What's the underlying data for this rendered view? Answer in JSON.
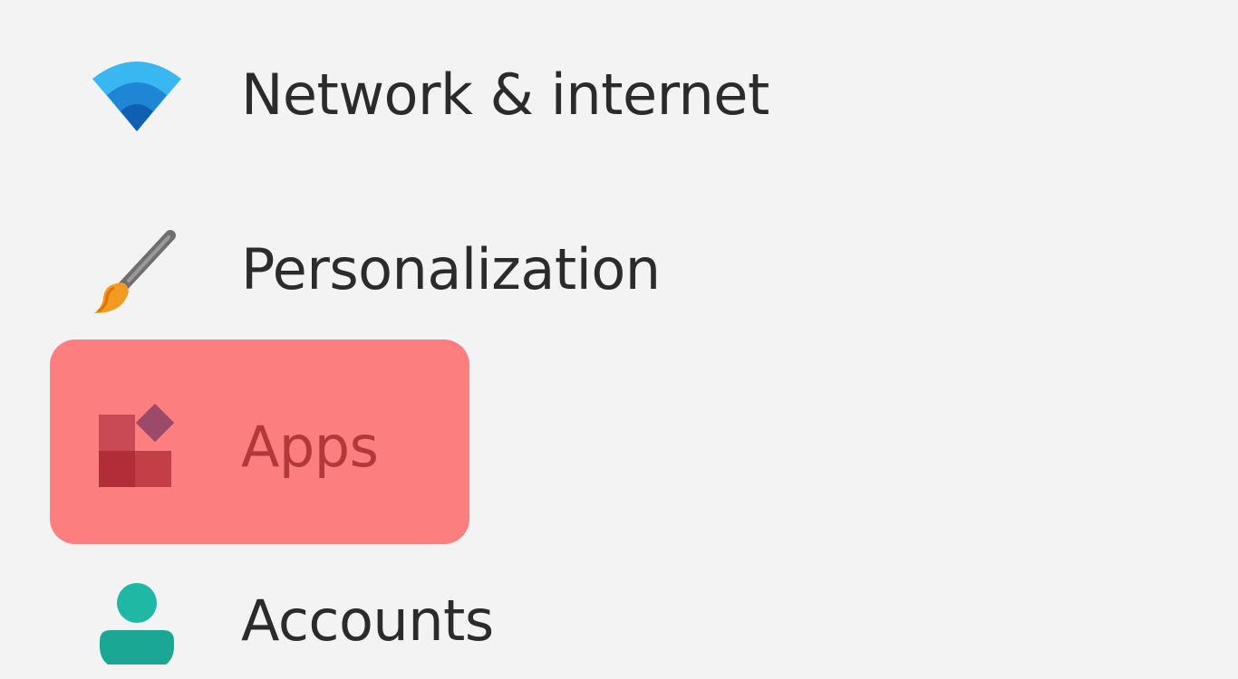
{
  "sidebar": {
    "items": [
      {
        "label": "Network & internet",
        "icon": "wifi-icon",
        "selected": false
      },
      {
        "label": "Personalization",
        "icon": "paintbrush-icon",
        "selected": false
      },
      {
        "label": "Apps",
        "icon": "apps-icon",
        "selected": true
      },
      {
        "label": "Accounts",
        "icon": "person-icon",
        "selected": false
      }
    ],
    "highlight_color": "#ff5050"
  }
}
